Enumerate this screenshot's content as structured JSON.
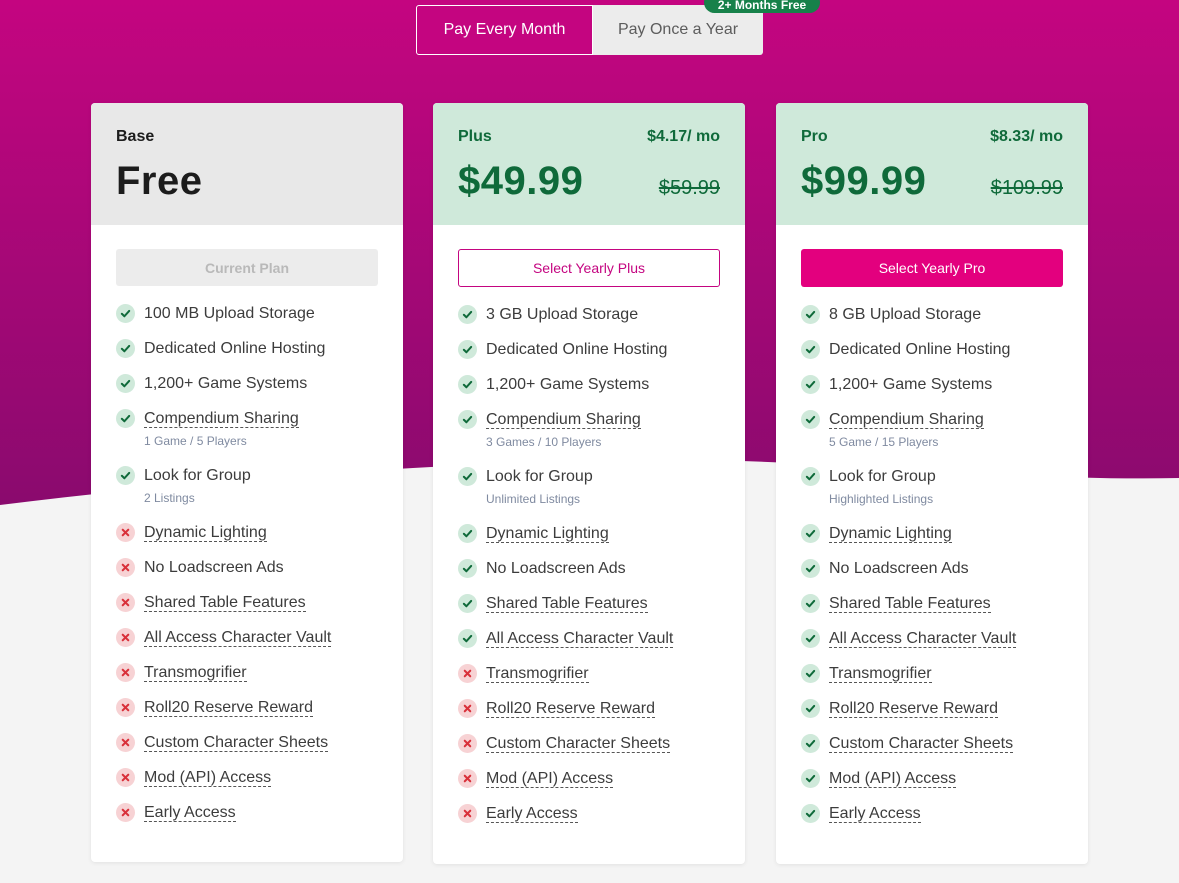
{
  "colors": {
    "brand_magenta": "#c40580",
    "brand_purple": "#8a0a6e",
    "accent_green": "#0f6a3a",
    "badge_green": "#17814a",
    "check_bg": "#cfe9da",
    "cross_bg": "#f7d2d4",
    "cross_fg": "#d9303a"
  },
  "billing_toggle": {
    "monthly_label": "Pay Every Month",
    "yearly_label": "Pay Once a Year",
    "badge": "2+ Months Free",
    "selected": "monthly"
  },
  "plans": [
    {
      "name": "Base",
      "price": "Free",
      "action_label": "Current Plan",
      "features": [
        {
          "label": "100 MB Upload Storage",
          "included": true,
          "underline": false
        },
        {
          "label": "Dedicated Online Hosting",
          "included": true,
          "underline": false
        },
        {
          "label": "1,200+ Game Systems",
          "included": true,
          "underline": false
        },
        {
          "label": "Compendium Sharing",
          "included": true,
          "underline": true,
          "sub": "1 Game / 5 Players"
        },
        {
          "label": "Look for Group",
          "included": true,
          "underline": false,
          "sub": "2 Listings"
        },
        {
          "label": "Dynamic Lighting",
          "included": false,
          "underline": true
        },
        {
          "label": "No Loadscreen Ads",
          "included": false,
          "underline": false
        },
        {
          "label": "Shared Table Features",
          "included": false,
          "underline": true
        },
        {
          "label": "All Access Character Vault",
          "included": false,
          "underline": true
        },
        {
          "label": "Transmogrifier",
          "included": false,
          "underline": true
        },
        {
          "label": "Roll20 Reserve Reward",
          "included": false,
          "underline": true
        },
        {
          "label": "Custom Character Sheets",
          "included": false,
          "underline": true
        },
        {
          "label": "Mod (API) Access",
          "included": false,
          "underline": true
        },
        {
          "label": "Early Access",
          "included": false,
          "underline": true
        }
      ]
    },
    {
      "name": "Plus",
      "per_month": "$4.17/ mo",
      "price": "$49.99",
      "old_price": "$59.99",
      "action_label": "Select Yearly Plus",
      "features": [
        {
          "label": "3 GB Upload Storage",
          "included": true,
          "underline": false
        },
        {
          "label": "Dedicated Online Hosting",
          "included": true,
          "underline": false
        },
        {
          "label": "1,200+ Game Systems",
          "included": true,
          "underline": false
        },
        {
          "label": "Compendium Sharing",
          "included": true,
          "underline": true,
          "sub": "3 Games / 10 Players"
        },
        {
          "label": "Look for Group",
          "included": true,
          "underline": false,
          "sub": "Unlimited Listings"
        },
        {
          "label": "Dynamic Lighting",
          "included": true,
          "underline": true
        },
        {
          "label": "No Loadscreen Ads",
          "included": true,
          "underline": false
        },
        {
          "label": "Shared Table Features",
          "included": true,
          "underline": true
        },
        {
          "label": "All Access Character Vault",
          "included": true,
          "underline": true
        },
        {
          "label": "Transmogrifier",
          "included": false,
          "underline": true
        },
        {
          "label": "Roll20 Reserve Reward",
          "included": false,
          "underline": true
        },
        {
          "label": "Custom Character Sheets",
          "included": false,
          "underline": true
        },
        {
          "label": "Mod (API) Access",
          "included": false,
          "underline": true
        },
        {
          "label": "Early Access",
          "included": false,
          "underline": true
        }
      ]
    },
    {
      "name": "Pro",
      "per_month": "$8.33/ mo",
      "price": "$99.99",
      "old_price": "$109.99",
      "action_label": "Select Yearly Pro",
      "features": [
        {
          "label": "8 GB Upload Storage",
          "included": true,
          "underline": false
        },
        {
          "label": "Dedicated Online Hosting",
          "included": true,
          "underline": false
        },
        {
          "label": "1,200+ Game Systems",
          "included": true,
          "underline": false
        },
        {
          "label": "Compendium Sharing",
          "included": true,
          "underline": true,
          "sub": "5 Game / 15 Players"
        },
        {
          "label": "Look for Group",
          "included": true,
          "underline": false,
          "sub": "Highlighted Listings"
        },
        {
          "label": "Dynamic Lighting",
          "included": true,
          "underline": true
        },
        {
          "label": "No Loadscreen Ads",
          "included": true,
          "underline": false
        },
        {
          "label": "Shared Table Features",
          "included": true,
          "underline": true
        },
        {
          "label": "All Access Character Vault",
          "included": true,
          "underline": true
        },
        {
          "label": "Transmogrifier",
          "included": true,
          "underline": true
        },
        {
          "label": "Roll20 Reserve Reward",
          "included": true,
          "underline": true
        },
        {
          "label": "Custom Character Sheets",
          "included": true,
          "underline": true
        },
        {
          "label": "Mod (API) Access",
          "included": true,
          "underline": true
        },
        {
          "label": "Early Access",
          "included": true,
          "underline": true
        }
      ]
    }
  ]
}
